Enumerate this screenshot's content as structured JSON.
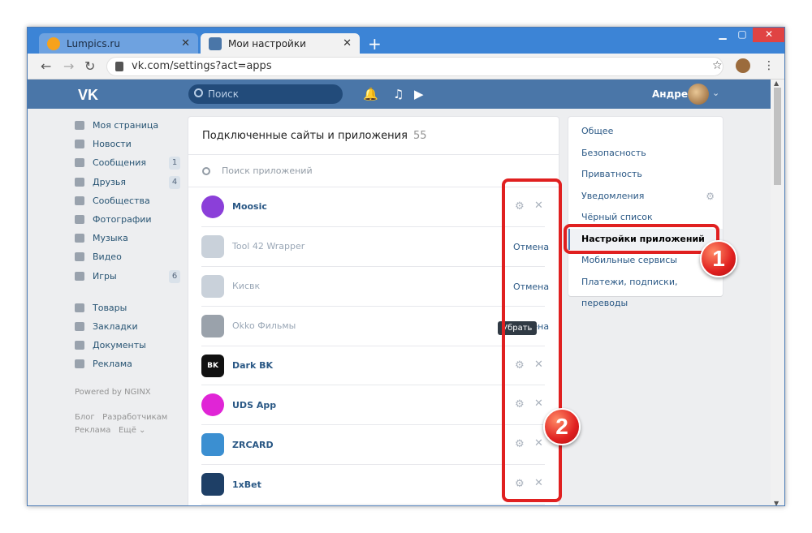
{
  "browser": {
    "tabs": [
      {
        "title": "Lumpics.ru",
        "fav_color": "#f7a21b"
      },
      {
        "title": "Мои настройки",
        "fav_color": "#4a76a8"
      }
    ],
    "url": "vk.com/settings?act=apps"
  },
  "header": {
    "logo": "VK",
    "search_placeholder": "Поиск",
    "user_name": "Андрей"
  },
  "leftnav": {
    "items": [
      {
        "label": "Моя страница",
        "count": ""
      },
      {
        "label": "Новости",
        "count": ""
      },
      {
        "label": "Сообщения",
        "count": "1"
      },
      {
        "label": "Друзья",
        "count": "4"
      },
      {
        "label": "Сообщества",
        "count": ""
      },
      {
        "label": "Фотографии",
        "count": ""
      },
      {
        "label": "Музыка",
        "count": ""
      },
      {
        "label": "Видео",
        "count": ""
      },
      {
        "label": "Игры",
        "count": "6"
      }
    ],
    "items2": [
      {
        "label": "Товары"
      },
      {
        "label": "Закладки"
      },
      {
        "label": "Документы"
      },
      {
        "label": "Реклама"
      }
    ],
    "powered": "Powered by NGINX",
    "footer": {
      "blog": "Блог",
      "dev": "Разработчикам",
      "ads": "Реклама",
      "more": "Ещё"
    }
  },
  "apps": {
    "title": "Подключенные сайты и приложения",
    "count": "55",
    "search_placeholder": "Поиск приложений",
    "undo_label": "Отмена",
    "tooltip": "Убрать",
    "rows": [
      {
        "name": "Moosic",
        "removed": false,
        "logo_color": "#8b3fd9",
        "logo_text": ""
      },
      {
        "name": "Tool 42 Wrapper",
        "removed": true,
        "logo_color": "#c9d1da",
        "logo_text": ""
      },
      {
        "name": "Кисвк",
        "removed": true,
        "logo_color": "#c9d1da",
        "logo_text": ""
      },
      {
        "name": "Okko Фильмы",
        "removed": true,
        "logo_color": "#9aa2ab",
        "logo_text": ""
      },
      {
        "name": "Dark BK",
        "removed": false,
        "logo_color": "#111111",
        "logo_text": "BK"
      },
      {
        "name": "UDS App",
        "removed": false,
        "logo_color": "#e025d6",
        "logo_text": ""
      },
      {
        "name": "ZRCARD",
        "removed": false,
        "logo_color": "#3b8fd1",
        "logo_text": ""
      },
      {
        "name": "1xBet",
        "removed": false,
        "logo_color": "#1e3f66",
        "logo_text": ""
      }
    ]
  },
  "settings_menu": {
    "items": [
      {
        "label": "Общее"
      },
      {
        "label": "Безопасность"
      },
      {
        "label": "Приватность"
      },
      {
        "label": "Уведомления"
      },
      {
        "label": "Чёрный список"
      },
      {
        "label": "Настройки приложений"
      },
      {
        "label": "Мобильные сервисы"
      },
      {
        "label": "Платежи, подписки, переводы"
      }
    ],
    "active_index": 5
  },
  "annotations": {
    "badge1": "1",
    "badge2": "2"
  }
}
